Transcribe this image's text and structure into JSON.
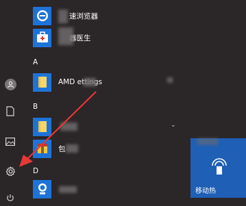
{
  "colors": {
    "background": "#2b2627",
    "tile_blue": "#1e73d8",
    "arrow_red": "#e53935",
    "live_tile": "#1f5fb5"
  },
  "rail": {
    "items": [
      {
        "name": "user-avatar",
        "icon": "person-icon"
      },
      {
        "name": "documents",
        "icon": "document-icon"
      },
      {
        "name": "pictures",
        "icon": "picture-icon"
      },
      {
        "name": "settings",
        "icon": "gear-icon"
      },
      {
        "name": "power",
        "icon": "power-icon"
      }
    ]
  },
  "apps": [
    {
      "label": "速浏览器",
      "icon": "browser-icon"
    },
    {
      "label": "器医生",
      "icon": "medkit-icon"
    }
  ],
  "sections": [
    {
      "letter": "A",
      "apps": [
        {
          "label": "AMD ettings",
          "icon": "folder-icon"
        }
      ]
    },
    {
      "letter": "B",
      "apps": [
        {
          "label": "",
          "icon": "folder-icon"
        },
        {
          "label": "包",
          "icon": "archive-icon"
        }
      ]
    },
    {
      "letter": "D",
      "apps": [
        {
          "label": "",
          "icon": "person-app-icon"
        }
      ]
    }
  ],
  "tile": {
    "label": "移动热",
    "icon": "hotspot-icon"
  }
}
